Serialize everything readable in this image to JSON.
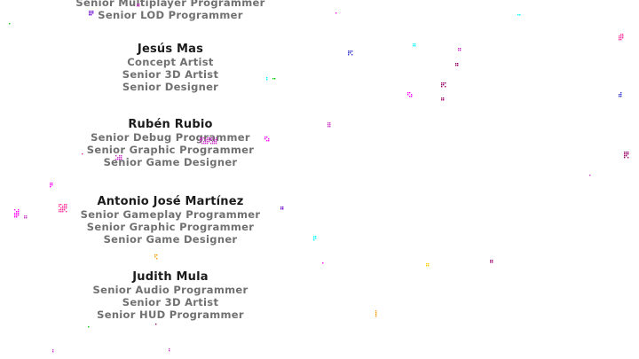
{
  "credits": [
    {
      "name": "",
      "roles": [
        "Senior Multiplayer Programmer",
        "Senior LOD Programmer"
      ]
    },
    {
      "name": "Jesús Mas",
      "roles": [
        "Concept Artist",
        "Senior 3D Artist",
        "Senior Designer"
      ]
    },
    {
      "name": "Rubén Rubio",
      "roles": [
        "Senior Debug Programmer",
        "Senior Graphic Programmer",
        "Senior Game Designer"
      ]
    },
    {
      "name": "Antonio José Martínez",
      "roles": [
        "Senior Gameplay Programmer",
        "Senior Graphic Programmer",
        "Senior Game Designer"
      ]
    },
    {
      "name": "Judith Mula",
      "roles": [
        "Senior Audio Programmer",
        "Senior 3D Artist",
        "Senior HUD Programmer"
      ]
    }
  ],
  "colors": {
    "background": "#ffffff",
    "name_text": "#1b1b1b",
    "role_text": "#707070",
    "particle_palette": [
      "#ff00ff",
      "#00ffff",
      "#3333cc",
      "#cc33cc",
      "#990066",
      "#ffcc00",
      "#00cc00",
      "#ff9900",
      "#ff3399",
      "#6600cc"
    ]
  }
}
